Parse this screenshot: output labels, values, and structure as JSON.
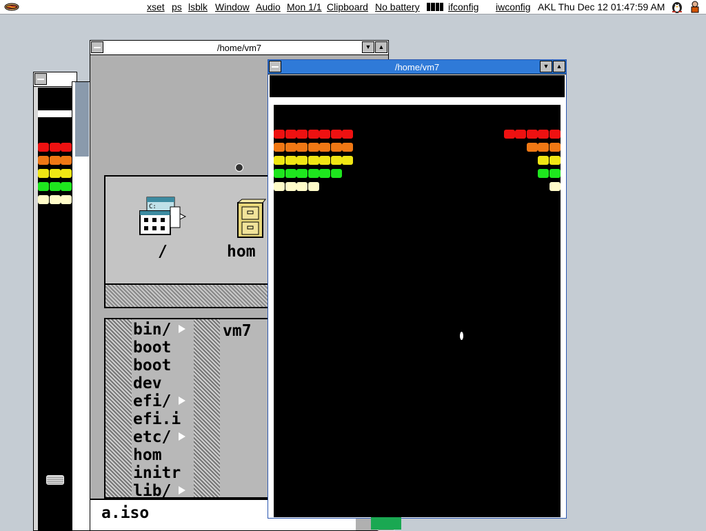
{
  "menubar": {
    "items": [
      "xset",
      "ps",
      "lsblk",
      "Window",
      "Audio",
      "Mon 1/1",
      "Clipboard",
      "No battery",
      "ifconfig",
      "iwconfig"
    ],
    "clock": "AKL Thu Dec 12 01:47:59 AM"
  },
  "windows": {
    "file_manager": {
      "title": "/home/vm7",
      "icons": [
        {
          "label": "/",
          "icon": "drive-icon"
        },
        {
          "label": "hom",
          "icon": "filing-cabinet-icon"
        }
      ],
      "tree": [
        {
          "name": "bin/",
          "has_children": true
        },
        {
          "name": "boot",
          "has_children": false
        },
        {
          "name": "boot",
          "has_children": false
        },
        {
          "name": "dev",
          "has_children": false
        },
        {
          "name": "efi/",
          "has_children": true
        },
        {
          "name": "efi.i",
          "has_children": false
        },
        {
          "name": "etc/",
          "has_children": true
        },
        {
          "name": "hom",
          "has_children": false
        },
        {
          "name": "initr",
          "has_children": false
        },
        {
          "name": "lib/",
          "has_children": true
        }
      ],
      "current_folder": "vm7",
      "filename_field": "a.iso"
    },
    "game": {
      "title": "/home/vm7",
      "brick_colors": [
        "#ee1111",
        "#f07814",
        "#f0e614",
        "#1ee61e",
        "#fffbc8"
      ],
      "left_bricks_per_row": [
        7,
        7,
        7,
        6,
        4
      ],
      "right_bricks_per_row": [
        5,
        3,
        2,
        2,
        1
      ]
    },
    "background_game": {
      "brick_colors": [
        "#ee1111",
        "#f07814",
        "#f0e614",
        "#1ee61e",
        "#fffbc8"
      ],
      "bricks_per_row": [
        3,
        3,
        3,
        3,
        3
      ]
    }
  }
}
